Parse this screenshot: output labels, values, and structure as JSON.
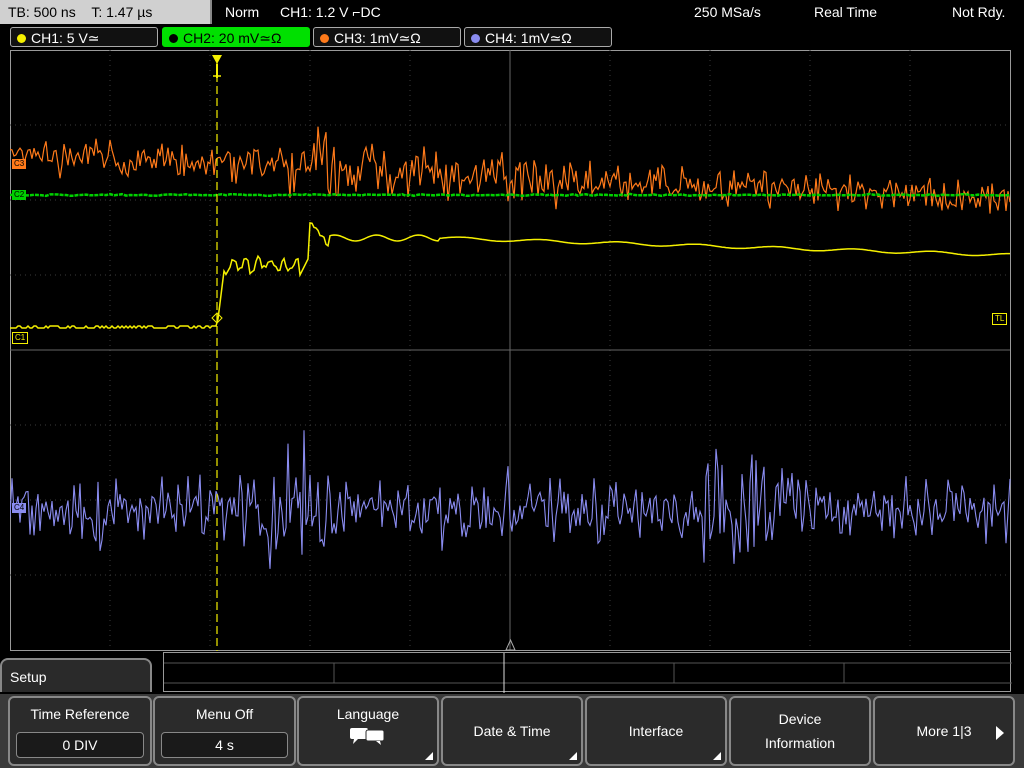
{
  "topbar": {
    "timebase": "TB: 500 ns",
    "trigger_time": "T: 1.47 µs",
    "mode": "Norm",
    "trigger_info": "CH1: 1.2 V ⌐DC",
    "sample_rate": "250 MSa/s",
    "acq_mode": "Real Time",
    "status": "Not Rdy."
  },
  "channels": [
    {
      "label": "CH1: 5 V≃",
      "color": "#f5f000"
    },
    {
      "label": "CH2: 20 mV≃Ω",
      "color": "#00d000"
    },
    {
      "label": "CH3: 1mV≃Ω",
      "color": "#ff7a1a"
    },
    {
      "label": "CH4: 1mV≃Ω",
      "color": "#8a8cf0"
    }
  ],
  "markers": {
    "c1": "C1",
    "c2": "C2",
    "c3": "C3",
    "c4": "C4",
    "tl": "TL"
  },
  "bottom": {
    "menu_title": "Setup",
    "softkeys": [
      {
        "title": "Time Reference",
        "value": "0 DIV"
      },
      {
        "title": "Menu Off",
        "value": "4 s"
      },
      {
        "title": "Language",
        "icon": "speech-bubbles-icon"
      },
      {
        "title": "Date & Time"
      },
      {
        "title": "Interface"
      },
      {
        "title": "Device",
        "title2": "Information"
      },
      {
        "title": "More 1|3",
        "icon": "arrow-right-icon"
      }
    ]
  }
}
